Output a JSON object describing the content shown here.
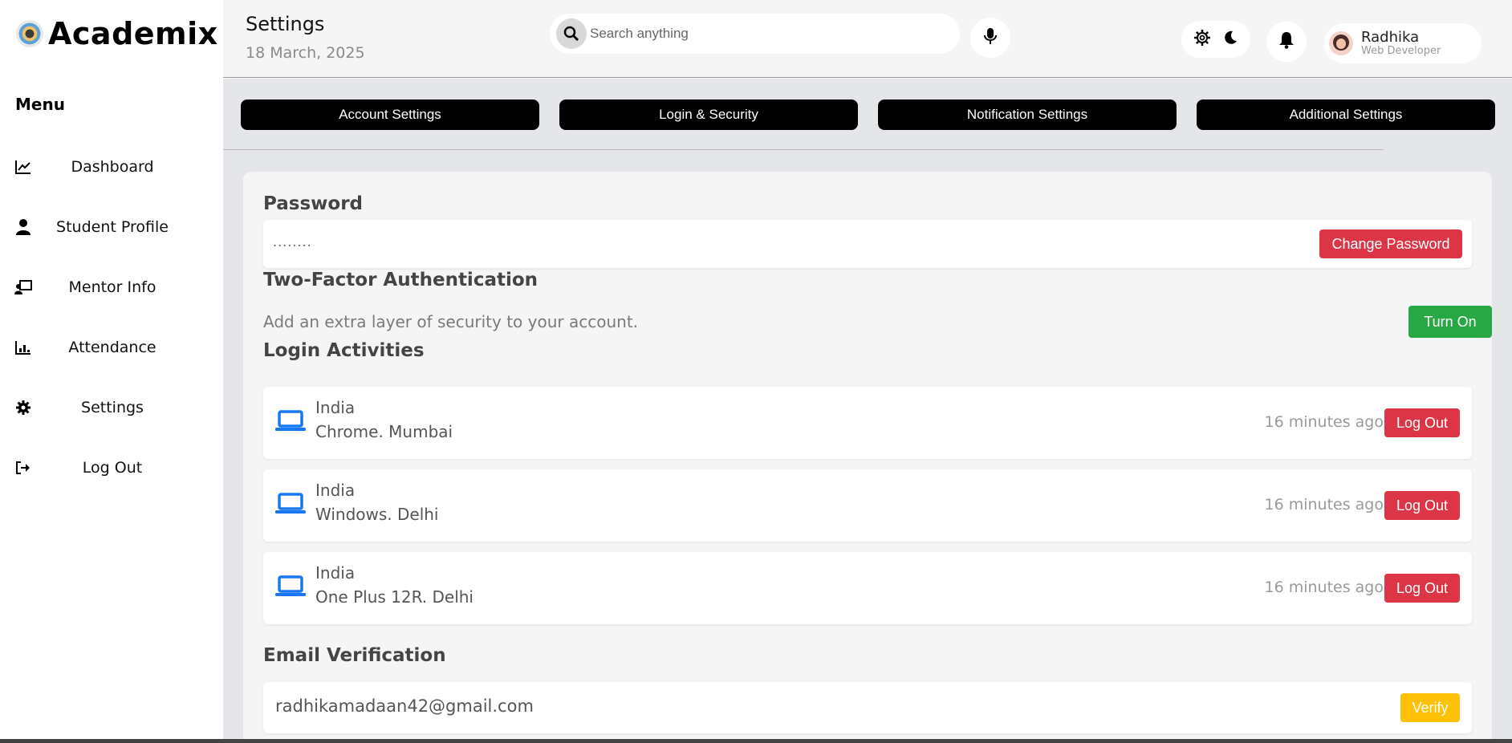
{
  "brand": {
    "name": "Academix"
  },
  "sidebar": {
    "menu_title": "Menu",
    "items": [
      {
        "label": "Dashboard",
        "icon": "chart-line-icon"
      },
      {
        "label": "Student Profile",
        "icon": "user-icon"
      },
      {
        "label": "Mentor Info",
        "icon": "chalkboard-teacher-icon"
      },
      {
        "label": "Attendance",
        "icon": "bar-chart-icon"
      },
      {
        "label": "Settings",
        "icon": "gear-icon"
      },
      {
        "label": "Log Out",
        "icon": "sign-out-icon"
      }
    ]
  },
  "header": {
    "title": "Settings",
    "date": "18 March, 2025",
    "search_placeholder": "Search anything",
    "user": {
      "name": "Radhika",
      "role": "Web Developer"
    }
  },
  "tabs": [
    {
      "label": "Account Settings"
    },
    {
      "label": "Login & Security"
    },
    {
      "label": "Notification Settings"
    },
    {
      "label": "Additional Settings"
    }
  ],
  "password": {
    "title": "Password",
    "mask": "........",
    "change_label": "Change Password"
  },
  "two_factor": {
    "title": "Two-Factor Authentication",
    "description": "Add an extra layer of security to your account.",
    "button_label": "Turn On"
  },
  "login_activities": {
    "title": "Login Activities",
    "items": [
      {
        "country": "India",
        "device": "Chrome. Mumbai",
        "time": "16 minutes ago",
        "action": "Log Out"
      },
      {
        "country": "India",
        "device": "Windows. Delhi",
        "time": "16 minutes ago",
        "action": "Log Out"
      },
      {
        "country": "India",
        "device": "One Plus 12R. Delhi",
        "time": "16 minutes ago",
        "action": "Log Out"
      }
    ]
  },
  "email_verification": {
    "title": "Email Verification",
    "email": "radhikamadaan42@gmail.com",
    "button_label": "Verify"
  },
  "colors": {
    "danger": "#dc3545",
    "success": "#28a745",
    "warning": "#ffc107",
    "accent": "#1877f2"
  }
}
